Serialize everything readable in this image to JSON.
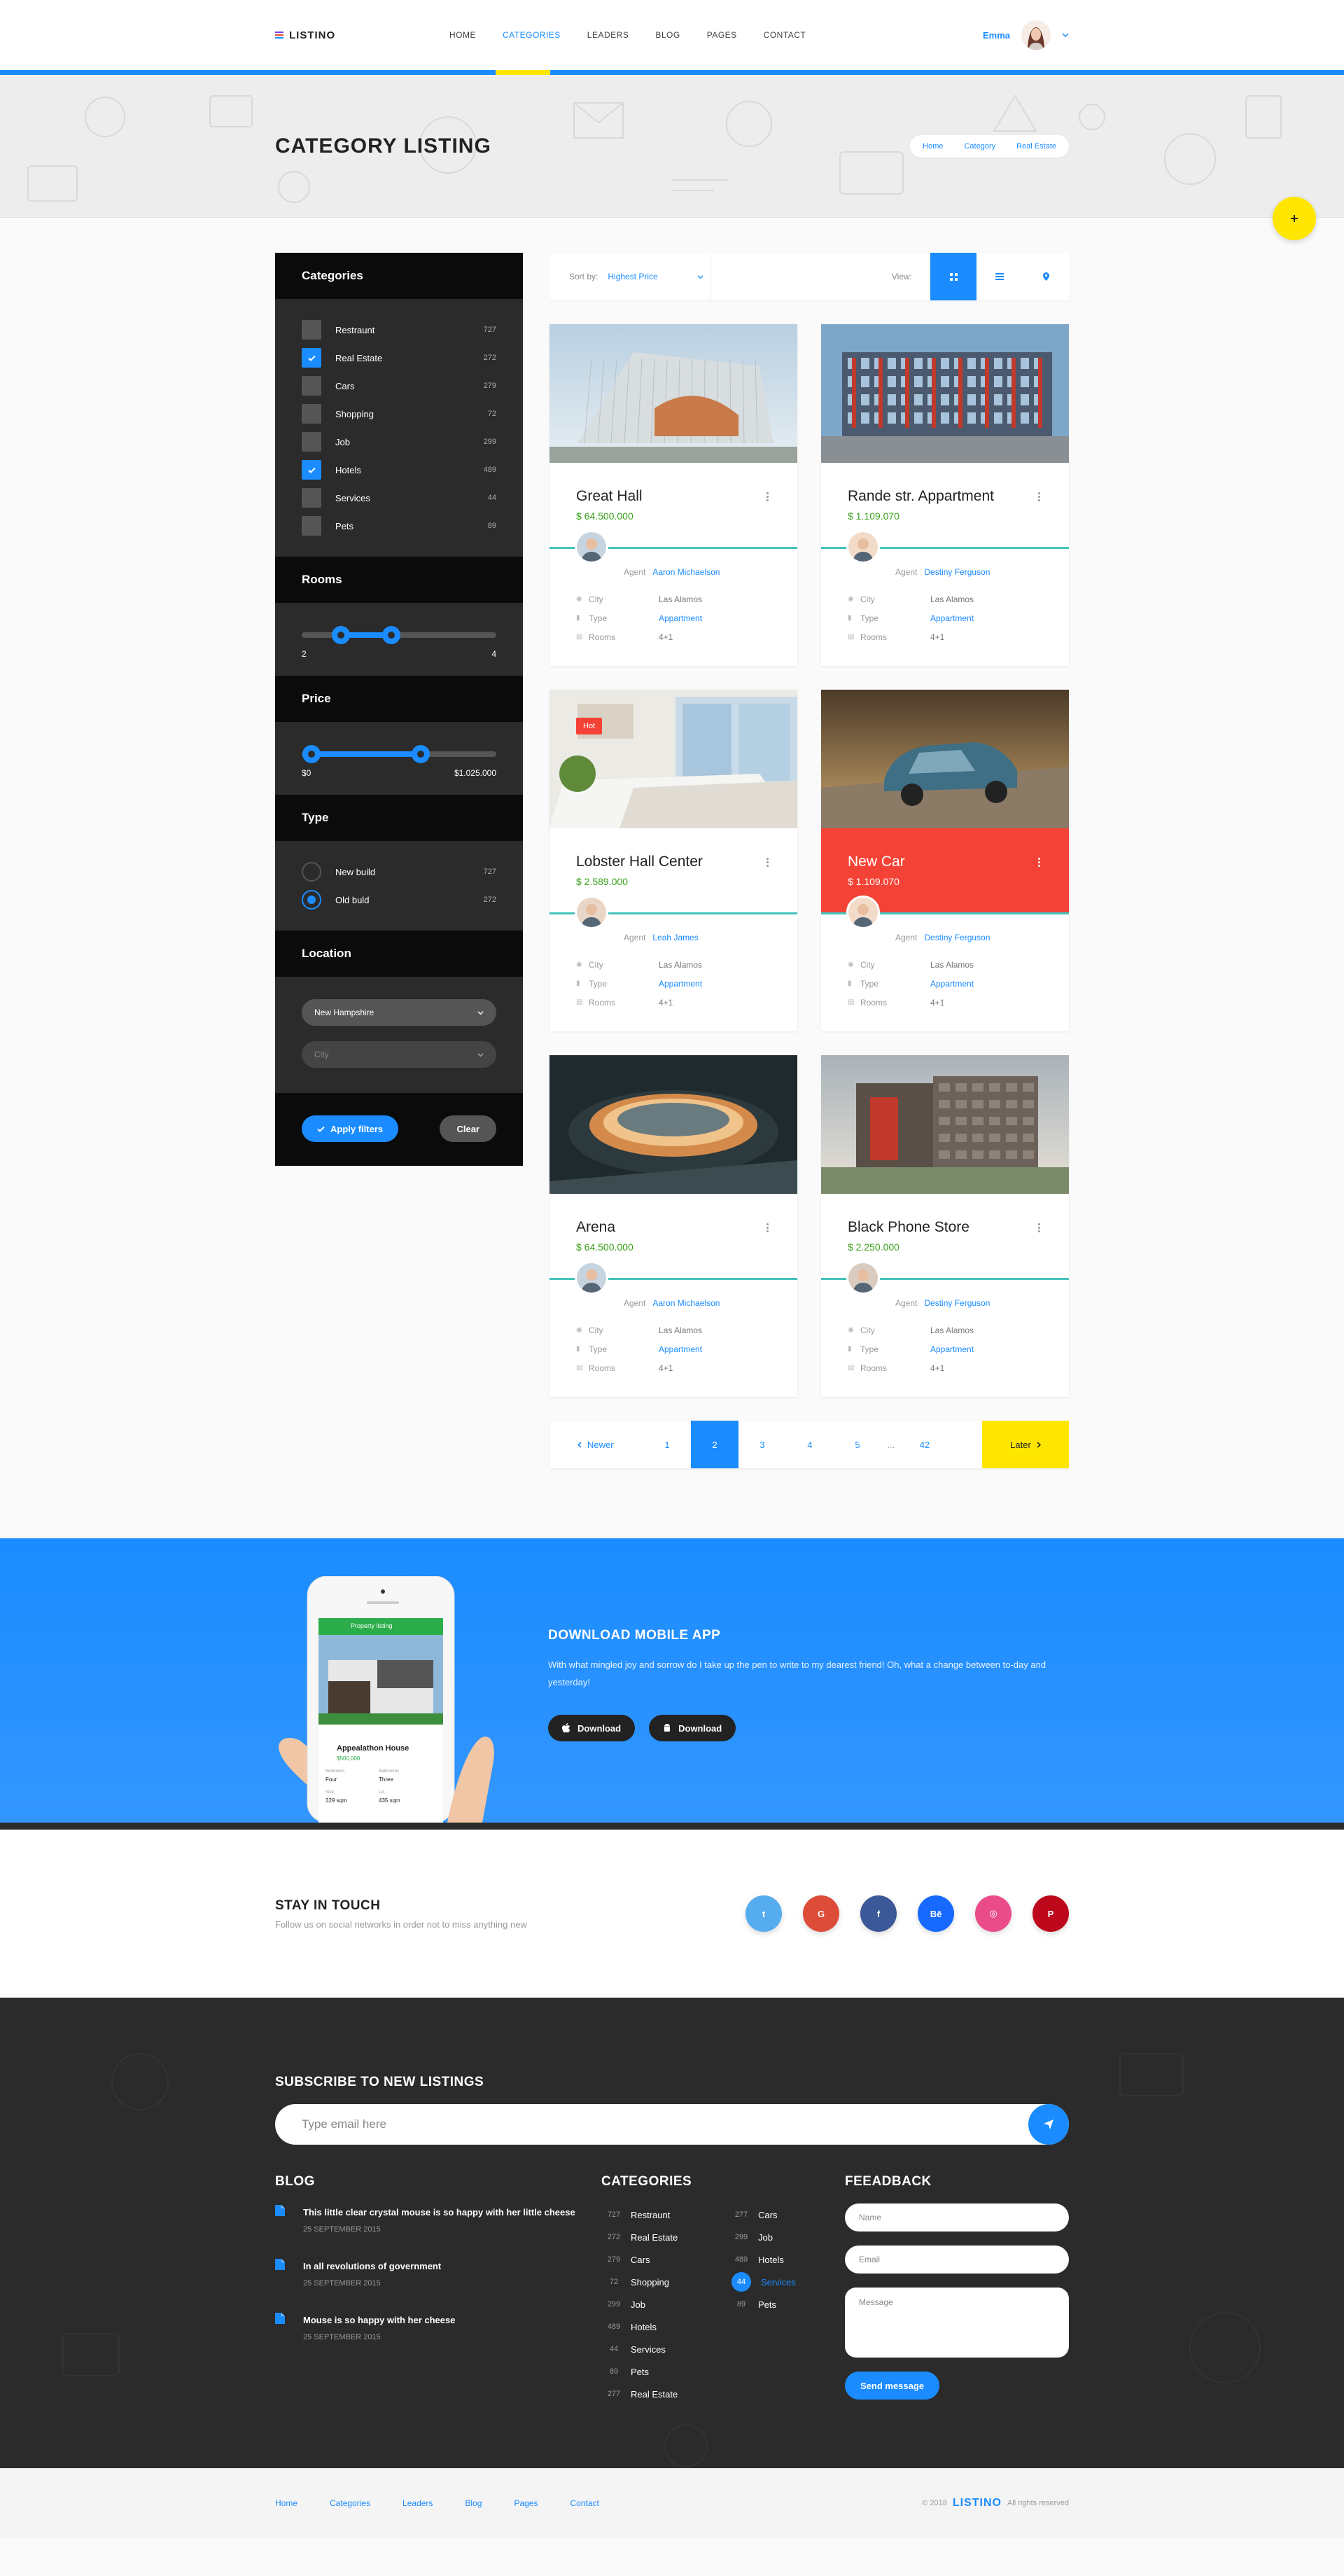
{
  "header": {
    "logo": "LISTINO",
    "nav": [
      "HOME",
      "CATEGORIES",
      "LEADERS",
      "BLOG",
      "PAGES",
      "CONTACT"
    ],
    "active_nav": 1,
    "user_name": "Emma"
  },
  "hero": {
    "title": "CATEGORY LISTING",
    "breadcrumbs": [
      "Home",
      "Category",
      "Real Estate"
    ],
    "fab_icon": "plus-icon"
  },
  "sidebar": {
    "categories_title": "Categories",
    "categories": [
      {
        "label": "Restraunt",
        "count": "727",
        "checked": false
      },
      {
        "label": "Real Estate",
        "count": "272",
        "checked": true
      },
      {
        "label": "Cars",
        "count": "279",
        "checked": false
      },
      {
        "label": "Shopping",
        "count": "72",
        "checked": false
      },
      {
        "label": "Job",
        "count": "299",
        "checked": false
      },
      {
        "label": "Hotels",
        "count": "489",
        "checked": true
      },
      {
        "label": "Services",
        "count": "44",
        "checked": false
      },
      {
        "label": "Pets",
        "count": "89",
        "checked": false
      }
    ],
    "rooms_title": "Rooms",
    "rooms": {
      "min_label": "2",
      "max_label": "4",
      "low": 0.2,
      "high": 0.46
    },
    "price_title": "Price",
    "price": {
      "min_label": "$0",
      "max_label": "$1.025.000",
      "low": 0.05,
      "high": 0.61
    },
    "type_title": "Type",
    "types": [
      {
        "label": "New build",
        "count": "727",
        "selected": false
      },
      {
        "label": "Old buld",
        "count": "272",
        "selected": true
      }
    ],
    "location_title": "Location",
    "location_value": "New Hampshire",
    "city_placeholder": "City",
    "apply_label": "Apply filters",
    "clear_label": "Clear"
  },
  "toolbar": {
    "sort_label": "Sort by:",
    "sort_value": "Highest Price",
    "view_label": "View:"
  },
  "cards": [
    {
      "title": "Great Hall",
      "price": "$ 64.500.000",
      "agent_label": "Agent",
      "agent": "Aaron Michaelson",
      "city_k": "City",
      "city": "Las Alamos",
      "type_k": "Type",
      "type": "Appartment",
      "rooms_k": "Rooms",
      "rooms": "4+1",
      "badge": "",
      "featured": false
    },
    {
      "title": "Rande str. Appartment",
      "price": "$ 1.109.070",
      "agent_label": "Agent",
      "agent": "Destiny Ferguson",
      "city_k": "City",
      "city": "Las Alamos",
      "type_k": "Type",
      "type": "Appartment",
      "rooms_k": "Rooms",
      "rooms": "4+1",
      "badge": "",
      "featured": false
    },
    {
      "title": "Lobster Hall Center",
      "price": "$ 2.589.000",
      "agent_label": "Agent",
      "agent": "Leah James",
      "city_k": "City",
      "city": "Las Alamos",
      "type_k": "Type",
      "type": "Appartment",
      "rooms_k": "Rooms",
      "rooms": "4+1",
      "badge": "Hot",
      "featured": false
    },
    {
      "title": "New Car",
      "price": "$ 1.109.070",
      "agent_label": "Agent",
      "agent": "Destiny Ferguson",
      "city_k": "City",
      "city": "Las Alamos",
      "type_k": "Type",
      "type": "Appartment",
      "rooms_k": "Rooms",
      "rooms": "4+1",
      "badge": "",
      "featured": true
    },
    {
      "title": "Arena",
      "price": "$ 64.500.000",
      "agent_label": "Agent",
      "agent": "Aaron Michaelson",
      "city_k": "City",
      "city": "Las Alamos",
      "type_k": "Type",
      "type": "Appartment",
      "rooms_k": "Rooms",
      "rooms": "4+1",
      "badge": "",
      "featured": false
    },
    {
      "title": "Black Phone Store",
      "price": "$ 2.250.000",
      "agent_label": "Agent",
      "agent": "Destiny Ferguson",
      "city_k": "City",
      "city": "Las Alamos",
      "type_k": "Type",
      "type": "Appartment",
      "rooms_k": "Rooms",
      "rooms": "4+1",
      "badge": "",
      "featured": false
    }
  ],
  "pagination": {
    "newer": "Newer",
    "pages": [
      "1",
      "2",
      "3",
      "4",
      "5"
    ],
    "active": "2",
    "dots": "...",
    "last": "42",
    "later": "Later"
  },
  "app": {
    "title": "DOWNLOAD MOBILE APP",
    "desc": "With what mingled joy and sorrow do I take up the pen to write to my dearest friend! Oh, what a change between to-day and yesterday!",
    "btn1": "Download",
    "btn2": "Download",
    "phone_title": "Property listing",
    "phone_card_title": "Appealathon House",
    "phone_card_price": "$500,000",
    "phone_bed_k": "Bedrooms",
    "phone_bed_v": "Four",
    "phone_bath_k": "Bathrooms",
    "phone_bath_v": "Three",
    "phone_size_k": "Size",
    "phone_size_v": "329 sqm",
    "phone_lot_k": "Lot",
    "phone_lot_v": "435 sqm"
  },
  "touch": {
    "title": "STAY IN TOUCH",
    "sub": "Follow us on social networks in order not to miss anything new",
    "socials": [
      {
        "name": "twitter",
        "glyph": "t",
        "color": "#55acee"
      },
      {
        "name": "google",
        "glyph": "G",
        "color": "#dd4b39"
      },
      {
        "name": "facebook",
        "glyph": "f",
        "color": "#3b5998"
      },
      {
        "name": "behance",
        "glyph": "Bē",
        "color": "#1769ff"
      },
      {
        "name": "dribbble",
        "glyph": "◎",
        "color": "#ea4c89"
      },
      {
        "name": "pinterest",
        "glyph": "P",
        "color": "#bd081c"
      }
    ]
  },
  "footer": {
    "subscribe_title": "SUBSCRIBE TO NEW LISTINGS",
    "email_placeholder": "Type email here",
    "blog_title": "BLOG",
    "blog": [
      {
        "title": "This little clear crystal mouse is so happy with her little cheese",
        "date": "25 SEPTEMBER 2015"
      },
      {
        "title": "In all revolutions of government",
        "date": "25 SEPTEMBER 2015"
      },
      {
        "title": "Mouse is so happy with her cheese",
        "date": "25 SEPTEMBER 2015"
      }
    ],
    "cats_title": "CATEGORIES",
    "cats_col1": [
      {
        "n": "727",
        "t": "Restraunt"
      },
      {
        "n": "272",
        "t": "Real Estate"
      },
      {
        "n": "279",
        "t": "Cars"
      },
      {
        "n": "72",
        "t": "Shopping"
      },
      {
        "n": "299",
        "t": "Job"
      },
      {
        "n": "489",
        "t": "Hotels"
      },
      {
        "n": "44",
        "t": "Services"
      },
      {
        "n": "89",
        "t": "Pets"
      },
      {
        "n": "277",
        "t": "Real Estate"
      }
    ],
    "cats_col2": [
      {
        "n": "277",
        "t": "Cars",
        "act": false
      },
      {
        "n": "299",
        "t": "Job",
        "act": false
      },
      {
        "n": "489",
        "t": "Hotels",
        "act": false
      },
      {
        "n": "44",
        "t": "Services",
        "act": true
      },
      {
        "n": "89",
        "t": "Pets",
        "act": false
      }
    ],
    "feedback_title": "FEEADBACK",
    "name_ph": "Name",
    "email_ph": "Email",
    "message_ph": "Message",
    "send_label": "Send message"
  },
  "bottom": {
    "links": [
      "Home",
      "Categories",
      "Leaders",
      "Blog",
      "Pages",
      "Contact"
    ],
    "copy_year": "© 2018",
    "copy_brand": "LISTINO",
    "copy_rights": "All rights reserved"
  },
  "colors": {
    "accent": "#1a8cff",
    "yellow": "#ffe600",
    "featured": "#f44336",
    "price": "#3aa11a",
    "teal": "#43c3bb"
  }
}
